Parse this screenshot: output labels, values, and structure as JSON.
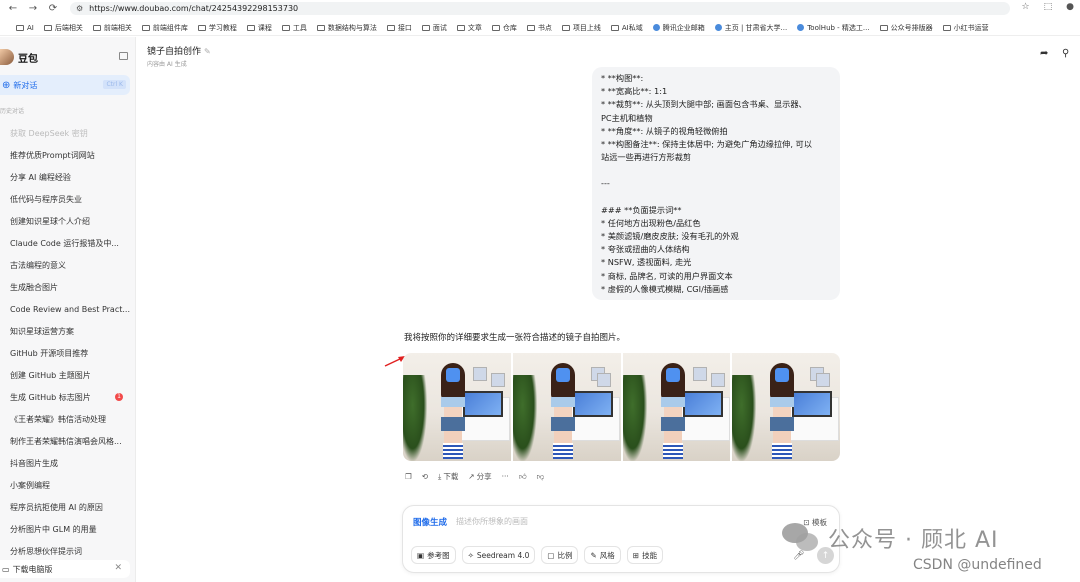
{
  "browser": {
    "url": "https://www.doubao.com/chat/24254392298153730",
    "bookmarks": [
      "AI",
      "后端相关",
      "前端相关",
      "前端组件库",
      "学习教程",
      "课程",
      "工具",
      "数据结构与算法",
      "接口",
      "面试",
      "文章",
      "仓库",
      "书点",
      "项目上线",
      "AI私域",
      "腾讯企业邮箱",
      "主页 | 甘肃省大学...",
      "ToolHub - 精选工...",
      "公众号排版器",
      "小红书运营"
    ]
  },
  "sidebar": {
    "brand": "豆包",
    "new_chat": "新对话",
    "new_chat_kbd": "Ctrl K",
    "history_label": "历史对话",
    "items": [
      {
        "label": "获取 DeepSeek 密钥",
        "faded": true
      },
      {
        "label": "推荐优质Prompt词网站"
      },
      {
        "label": "分享 AI 编程经验"
      },
      {
        "label": "低代码与程序员失业"
      },
      {
        "label": "创建知识星球个人介绍"
      },
      {
        "label": "Claude Code 运行报错及中..."
      },
      {
        "label": "古法编程的意义"
      },
      {
        "label": "生成融合图片"
      },
      {
        "label": "Code Review and Best Pract..."
      },
      {
        "label": "知识星球运营方案"
      },
      {
        "label": "GitHub 开源项目推荐"
      },
      {
        "label": "创建 GitHub 主题图片"
      },
      {
        "label": "生成 GitHub 标志图片",
        "badge": "1"
      },
      {
        "label": "《王者荣耀》韩信活动处理"
      },
      {
        "label": "制作王者荣耀韩信演唱会风格..."
      },
      {
        "label": "抖音图片生成"
      },
      {
        "label": "小案例编程"
      },
      {
        "label": "程序员抗拒使用 AI 的原因"
      },
      {
        "label": "分析图片中 GLM 的用量"
      },
      {
        "label": "分析思想伙伴提示词"
      }
    ],
    "download": "下载电脑版"
  },
  "header": {
    "title": "镜子自拍创作",
    "subtitle": "内容由 AI 生成"
  },
  "bubble": {
    "lines": [
      "* **构图**:",
      "* **宽高比**: 1:1",
      "* **裁剪**: 从头顶到大腿中部; 画面包含书桌、显示器、",
      "PC主机和植物",
      "* **角度**: 从镜子的视角轻微俯拍",
      "* **构图备注**: 保持主体居中; 为避免广角边缘拉伸, 可以",
      "站远一些再进行方形裁剪",
      "",
      "---",
      "",
      "### **负面提示词**",
      "* 任何地方出现粉色/品红色",
      "* 美颜滤镜/磨皮皮肤; 没有毛孔的外观",
      "* 夸张或扭曲的人体结构",
      "* NSFW, 透视面料, 走光",
      "* 商标, 品牌名, 可读的用户界面文本",
      "* 虚假的人像模式模糊, CGI/插画感"
    ]
  },
  "reply": {
    "text": "我将按照你的详细要求生成一张符合描述的镜子自拍图片。",
    "image_count": 4
  },
  "actions": {
    "download": "下载",
    "share": "分享"
  },
  "input": {
    "mode": "图像生成",
    "placeholder": "描述你所想象的画面",
    "template": "模板",
    "options": {
      "ref_image": "参考图",
      "model": "Seedream 4.0",
      "ratio": "比例",
      "style": "风格",
      "skill": "技能"
    }
  },
  "watermark": {
    "text": "公众号 · 顾北 AI",
    "csdn": "CSDN @undefined"
  }
}
